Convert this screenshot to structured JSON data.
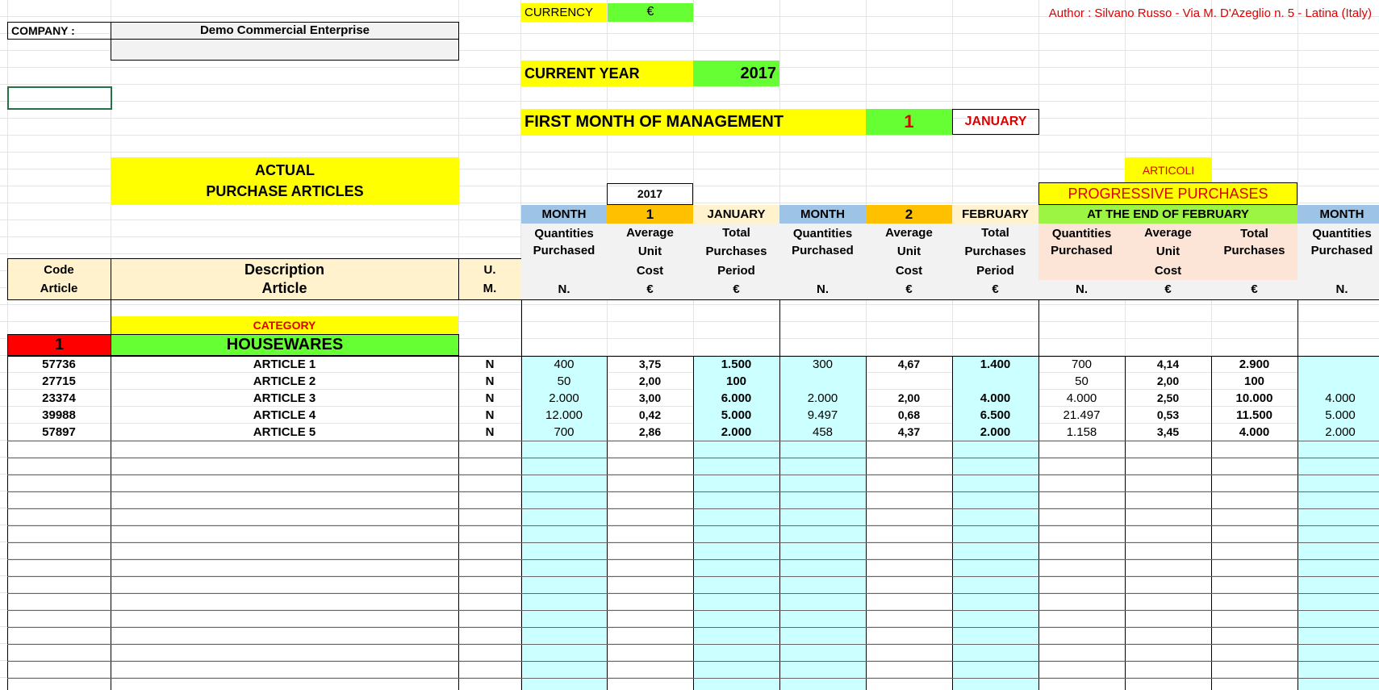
{
  "company_label": "COMPANY :",
  "company_name": "Demo Commercial Enterprise",
  "currency_label": "CURRENCY",
  "currency_symbol": "€",
  "author": "Author : Silvano Russo - Via M. D'Azeglio n. 5 - Latina (Italy)",
  "current_year_label": "CURRENT YEAR",
  "current_year": "2017",
  "first_month_label": "FIRST MONTH OF MANAGEMENT",
  "first_month_num": "1",
  "first_month_name": "JANUARY",
  "title": "ACTUAL\nPURCHASE ARTICLES",
  "year_small": "2017",
  "articoli": "ARTICOLI",
  "progressive_label": "PROGRESSIVE PURCHASES",
  "progressive_sub": "AT THE END OF FEBRUARY",
  "month_word": "MONTH",
  "month1_num": "1",
  "month1_name": "JANUARY",
  "month2_num": "2",
  "month2_name": "FEBRUARY",
  "headers": {
    "code": "Code\nArticle",
    "description": "Description\nArticle",
    "um": "U.\nM.",
    "qty": "Quantities\nPurchased",
    "avg": "Average\nUnit\nCost",
    "total_period": "Total\nPurchases\nPeriod",
    "total": "Total\nPurchases"
  },
  "units": {
    "n": "N.",
    "cur": "€"
  },
  "category_label": "CATEGORY",
  "category_num": "1",
  "category_name": "HOUSEWARES",
  "rows": [
    {
      "code": "57736",
      "desc": "ARTICLE 1",
      "um": "N",
      "q1": "400",
      "a1": "3,75",
      "t1": "1.500",
      "q2": "300",
      "a2": "4,67",
      "t2": "1.400",
      "pq": "700",
      "pa": "4,14",
      "pt": "2.900",
      "q3": ""
    },
    {
      "code": "27715",
      "desc": "ARTICLE 2",
      "um": "N",
      "q1": "50",
      "a1": "2,00",
      "t1": "100",
      "q2": "",
      "a2": "",
      "t2": "",
      "pq": "50",
      "pa": "2,00",
      "pt": "100",
      "q3": ""
    },
    {
      "code": "23374",
      "desc": "ARTICLE 3",
      "um": "N",
      "q1": "2.000",
      "a1": "3,00",
      "t1": "6.000",
      "q2": "2.000",
      "a2": "2,00",
      "t2": "4.000",
      "pq": "4.000",
      "pa": "2,50",
      "pt": "10.000",
      "q3": "4.000"
    },
    {
      "code": "39988",
      "desc": "ARTICLE 4",
      "um": "N",
      "q1": "12.000",
      "a1": "0,42",
      "t1": "5.000",
      "q2": "9.497",
      "a2": "0,68",
      "t2": "6.500",
      "pq": "21.497",
      "pa": "0,53",
      "pt": "11.500",
      "q3": "5.000"
    },
    {
      "code": "57897",
      "desc": "ARTICLE 5",
      "um": "N",
      "q1": "700",
      "a1": "2,86",
      "t1": "2.000",
      "q2": "458",
      "a2": "4,37",
      "t2": "2.000",
      "pq": "1.158",
      "pa": "3,45",
      "pt": "4.000",
      "q3": "2.000"
    }
  ]
}
